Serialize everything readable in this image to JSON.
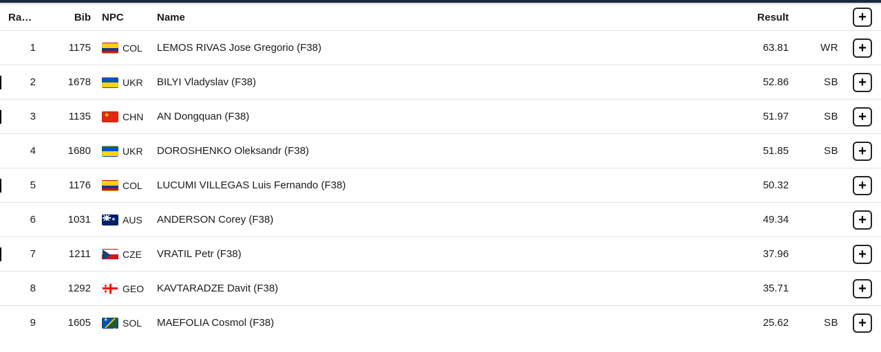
{
  "headers": {
    "rank": "Rank",
    "bib": "Bib",
    "npc": "NPC",
    "name": "Name",
    "result": "Result"
  },
  "sort_indicator": "↑",
  "expand_glyph": "+",
  "rows": [
    {
      "rank": "1",
      "bib": "1175",
      "npc": "COL",
      "flag": "flag-col",
      "name": "LEMOS RIVAS Jose Gregorio",
      "class": "F38",
      "result": "63.81",
      "record": "WR",
      "tick": false
    },
    {
      "rank": "2",
      "bib": "1678",
      "npc": "UKR",
      "flag": "flag-ukr",
      "name": "BILYI Vladyslav",
      "class": "F38",
      "result": "52.86",
      "record": "SB",
      "tick": true
    },
    {
      "rank": "3",
      "bib": "1135",
      "npc": "CHN",
      "flag": "flag-chn",
      "name": "AN Dongquan",
      "class": "F38",
      "result": "51.97",
      "record": "SB",
      "tick": true
    },
    {
      "rank": "4",
      "bib": "1680",
      "npc": "UKR",
      "flag": "flag-ukr",
      "name": "DOROSHENKO Oleksandr",
      "class": "F38",
      "result": "51.85",
      "record": "SB",
      "tick": false
    },
    {
      "rank": "5",
      "bib": "1176",
      "npc": "COL",
      "flag": "flag-col",
      "name": "LUCUMI VILLEGAS Luis Fernando",
      "class": "F38",
      "result": "50.32",
      "record": "",
      "tick": true
    },
    {
      "rank": "6",
      "bib": "1031",
      "npc": "AUS",
      "flag": "flag-aus",
      "name": "ANDERSON Corey",
      "class": "F38",
      "result": "49.34",
      "record": "",
      "tick": false
    },
    {
      "rank": "7",
      "bib": "1211",
      "npc": "CZE",
      "flag": "flag-cze",
      "name": "VRATIL Petr",
      "class": "F38",
      "result": "37.96",
      "record": "",
      "tick": true
    },
    {
      "rank": "8",
      "bib": "1292",
      "npc": "GEO",
      "flag": "flag-geo",
      "name": "KAVTARADZE Davit",
      "class": "F38",
      "result": "35.71",
      "record": "",
      "tick": false
    },
    {
      "rank": "9",
      "bib": "1605",
      "npc": "SOL",
      "flag": "flag-sol",
      "name": "MAEFOLIA Cosmol",
      "class": "F38",
      "result": "25.62",
      "record": "SB",
      "tick": false
    }
  ]
}
